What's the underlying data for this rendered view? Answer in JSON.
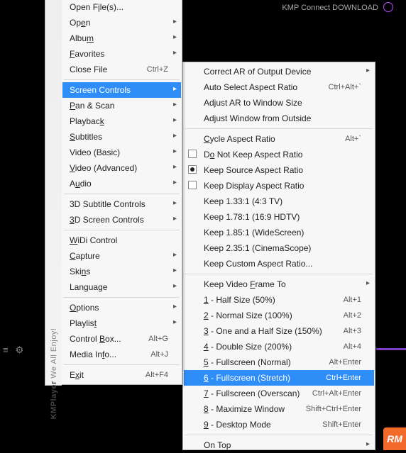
{
  "header": {
    "connect_text": "KMP Connect DOWNLOAD"
  },
  "sidebar": {
    "brand": "KMPlayer",
    "tagline": "We All Enjoy!"
  },
  "rm_badge": "RM",
  "left_menu": [
    {
      "label_html": "Open F<u>i</u>le(s)...",
      "shortcut": "",
      "sub": false
    },
    {
      "label_html": "Op<u>e</u>n",
      "shortcut": "",
      "sub": true
    },
    {
      "label_html": "Albu<u>m</u>",
      "shortcut": "",
      "sub": true
    },
    {
      "label_html": "<u>F</u>avorites",
      "shortcut": "",
      "sub": true
    },
    {
      "label_html": "Close File",
      "shortcut": "Ctrl+Z",
      "sub": false
    },
    {
      "sep": true
    },
    {
      "label_html": "Screen Controls",
      "shortcut": "",
      "sub": true,
      "hl": true
    },
    {
      "label_html": "<u>P</u>an & Scan",
      "shortcut": "",
      "sub": true
    },
    {
      "label_html": "Playbac<u>k</u>",
      "shortcut": "",
      "sub": true
    },
    {
      "label_html": "<u>S</u>ubtitles",
      "shortcut": "",
      "sub": true
    },
    {
      "label_html": "Video (Basic)",
      "shortcut": "",
      "sub": true
    },
    {
      "label_html": "<u>V</u>ideo (Advanced)",
      "shortcut": "",
      "sub": true
    },
    {
      "label_html": "A<u>u</u>dio",
      "shortcut": "",
      "sub": true
    },
    {
      "sep": true
    },
    {
      "label_html": "3D Subtitle Controls",
      "shortcut": "",
      "sub": true
    },
    {
      "label_html": "<u>3</u>D Screen Controls",
      "shortcut": "",
      "sub": true
    },
    {
      "sep": true
    },
    {
      "label_html": "<u>W</u>iDi Control",
      "shortcut": "",
      "sub": false
    },
    {
      "label_html": "<u>C</u>apture",
      "shortcut": "",
      "sub": true
    },
    {
      "label_html": "Ski<u>n</u>s",
      "shortcut": "",
      "sub": true
    },
    {
      "label_html": "Lan<u>g</u>uage",
      "shortcut": "",
      "sub": true
    },
    {
      "sep": true
    },
    {
      "label_html": "<u>O</u>ptions",
      "shortcut": "",
      "sub": true
    },
    {
      "label_html": "Playlis<u>t</u>",
      "shortcut": "",
      "sub": true
    },
    {
      "label_html": "Control <u>B</u>ox...",
      "shortcut": "Alt+G",
      "sub": false
    },
    {
      "label_html": "Media In<u>f</u>o...",
      "shortcut": "Alt+J",
      "sub": false
    },
    {
      "sep": true
    },
    {
      "label_html": "E<u>x</u>it",
      "shortcut": "Alt+F4",
      "sub": false
    }
  ],
  "right_menu": [
    {
      "label_html": "Correct AR of Output Device",
      "shortcut": "",
      "sub": true
    },
    {
      "label_html": "Auto Select Aspect Ratio",
      "shortcut": "Ctrl+Alt+`",
      "sub": false
    },
    {
      "label_html": "Adjust AR to Window Size",
      "shortcut": "",
      "sub": false
    },
    {
      "label_html": "Adjust Window from Outside",
      "shortcut": "",
      "sub": false
    },
    {
      "sep": true
    },
    {
      "label_html": "<u>C</u>ycle Aspect Ratio",
      "shortcut": "Alt+`",
      "sub": false
    },
    {
      "label_html": "D<u>o</u> Not Keep Aspect Ratio",
      "shortcut": "",
      "sub": false,
      "radio": false
    },
    {
      "label_html": "Keep Source Aspect Ratio",
      "shortcut": "",
      "sub": false,
      "radio": true
    },
    {
      "label_html": "Keep Display Aspect Ratio",
      "shortcut": "",
      "sub": false,
      "radio": false
    },
    {
      "label_html": "Keep 1.33:1 (4:3 TV)",
      "shortcut": "",
      "sub": false
    },
    {
      "label_html": "Keep 1.78:1 (16:9 HDTV)",
      "shortcut": "",
      "sub": false
    },
    {
      "label_html": "Keep 1.85:1 (WideScreen)",
      "shortcut": "",
      "sub": false
    },
    {
      "label_html": "Keep 2.35:1 (CinemaScope)",
      "shortcut": "",
      "sub": false
    },
    {
      "label_html": "Keep Custom Aspect Ratio...",
      "shortcut": "",
      "sub": false
    },
    {
      "sep": true
    },
    {
      "label_html": "Keep Video <u>F</u>rame To",
      "shortcut": "",
      "sub": true
    },
    {
      "label_html": "<u>1</u> - Half Size (50%)",
      "shortcut": "Alt+1",
      "sub": false
    },
    {
      "label_html": "<u>2</u> - Normal Size (100%)",
      "shortcut": "Alt+2",
      "sub": false
    },
    {
      "label_html": "<u>3</u> - One and a Half Size (150%)",
      "shortcut": "Alt+3",
      "sub": false
    },
    {
      "label_html": "<u>4</u> - Double Size (200%)",
      "shortcut": "Alt+4",
      "sub": false
    },
    {
      "label_html": "<u>5</u> - Fullscreen (Normal)",
      "shortcut": "Alt+Enter",
      "sub": false
    },
    {
      "label_html": "<u>6</u> - Fullscreen (Stretch)",
      "shortcut": "Ctrl+Enter",
      "sub": false,
      "hl": true
    },
    {
      "label_html": "<u>7</u> - Fullscreen (Overscan)",
      "shortcut": "Ctrl+Alt+Enter",
      "sub": false
    },
    {
      "label_html": "<u>8</u> - Maximize Window",
      "shortcut": "Shift+Ctrl+Enter",
      "sub": false
    },
    {
      "label_html": "<u>9</u> - Desktop Mode",
      "shortcut": "Shift+Enter",
      "sub": false
    },
    {
      "sep": true
    },
    {
      "label_html": "On Top",
      "shortcut": "",
      "sub": true
    }
  ]
}
